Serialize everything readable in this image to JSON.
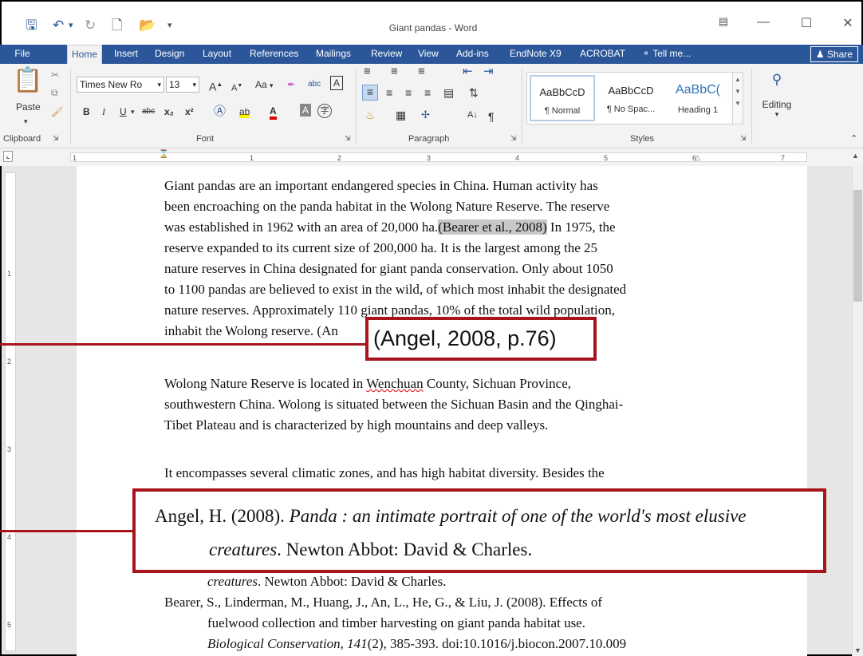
{
  "app": {
    "title": "Giant pandas - Word",
    "share_label": "Share",
    "tell_me": "Tell me..."
  },
  "tabs": [
    "File",
    "Home",
    "Insert",
    "Design",
    "Layout",
    "References",
    "Mailings",
    "Review",
    "View",
    "Add-ins",
    "EndNote X9",
    "ACROBAT"
  ],
  "ribbon": {
    "font_name": "Times New Ro",
    "font_size": "13",
    "paste_label": "Paste",
    "editing_label": "Editing",
    "groups": {
      "clipboard": "Clipboard",
      "font": "Font",
      "paragraph": "Paragraph",
      "styles": "Styles"
    },
    "styles": [
      {
        "preview": "AaBbCcD",
        "label": "¶ Normal"
      },
      {
        "preview": "AaBbCcD",
        "label": "¶ No Spac..."
      },
      {
        "preview": "AaBbC(",
        "label": "Heading 1"
      }
    ],
    "font_buttons": {
      "bold": "B",
      "italic": "I",
      "underline": "U",
      "strike": "abc",
      "sub": "x₂",
      "sup": "x²",
      "case": "Aa",
      "grow": "A",
      "shrink": "A"
    }
  },
  "ruler_numbers": [
    "1",
    "1",
    "2",
    "3",
    "4",
    "5",
    "6",
    "7"
  ],
  "vruler_numbers": [
    "1",
    "2",
    "3",
    "4",
    "5"
  ],
  "document": {
    "p1": [
      "Giant pandas are an important endangered species in China.    Human activity has",
      "been encroaching on the panda habitat in the Wolong Nature Reserve.    The reserve",
      "was established in 1962 with an area of 20,000 ha.",
      "(Bearer et al., 2008)",
      "    In 1975, the",
      "reserve expanded to its current size of 200,000 ha. It is the largest among the 25",
      "nature reserves in China designated for giant panda conservation.    Only about 1050",
      "to 1100 pandas are believed to exist in the wild, of which most inhabit the designated",
      "nature reserves. Approximately 110 giant pandas, 10% of the total wild population,",
      "inhabit the Wolong reserve. (An"
    ],
    "p2": [
      "Wolong Nature Reserve is located in ",
      "Wenchuan",
      " County, Sichuan Province,",
      "southwestern China. Wolong is situated between the Sichuan Basin and the Qinghai-",
      "Tibet Plateau and is characterized by high mountains and deep valleys."
    ],
    "p3": "It encompasses several climatic zones, and has high habitat diversity.    Besides the",
    "ref_tail": "creatures",
    "ref_tail2": ". Newton Abbot: David & Charles.",
    "ref2": [
      "Bearer, S., Linderman, M., Huang, J., An, L., He, G., & Liu, J. (2008). Effects of",
      "fuelwood collection and timber harvesting on giant panda habitat use.",
      "Biological Conservation, 141",
      "(2), 385-393. doi:10.1016/j.biocon.2007.10.009"
    ]
  },
  "callouts": {
    "citation": "(Angel, 2008, p.76)",
    "reference_a": "Angel, H. (2008). ",
    "reference_title": "Panda : an intimate portrait of one of the world's most elusive",
    "reference_title2": "creatures",
    "reference_b": ". Newton Abbot: David & Charles."
  },
  "colors": {
    "accent": "#2b579a",
    "callout": "#a8141b",
    "highlight": "#c8c8c8"
  }
}
